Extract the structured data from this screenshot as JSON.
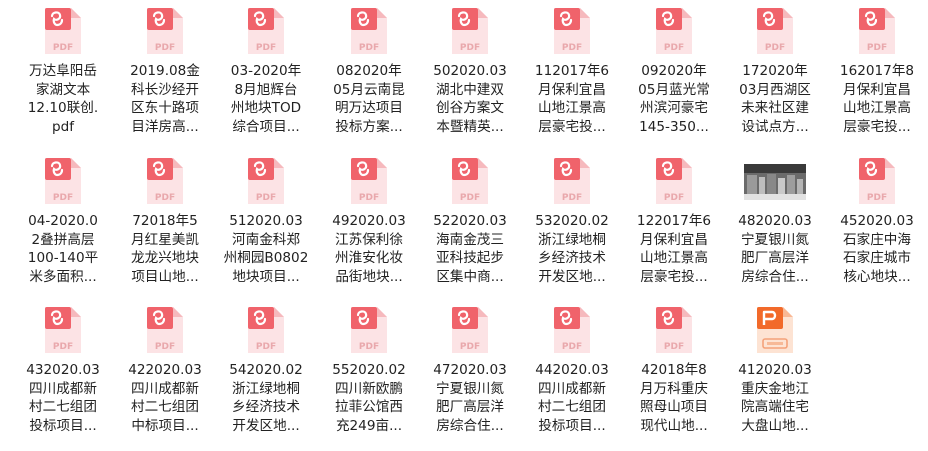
{
  "colors": {
    "pdf_red": "#F0636B",
    "pdf_light": "#FCE3E5",
    "wps_orange": "#F26A2A",
    "wps_light": "#FDE3D3",
    "label_text": "#222222"
  },
  "files": [
    {
      "name": "万达阜阳岳家湖文本12.10联创.pdf",
      "lines": [
        "万达阜阳岳",
        "家湖文本",
        "12.10联创.",
        "pdf"
      ],
      "icon": "pdf-icon"
    },
    {
      "name": "2019.08金科长沙经开区东十路项目洋房高...",
      "lines": [
        "2019.08金",
        "科长沙经开",
        "区东十路项",
        "目洋房高..."
      ],
      "icon": "pdf-icon"
    },
    {
      "name": "03-2020年8月旭辉台州地块TOD综合项目...",
      "lines": [
        "03-2020年",
        "8月旭辉台",
        "州地块TOD",
        "综合项目..."
      ],
      "icon": "pdf-icon"
    },
    {
      "name": "082020年05月云南昆明万达项目投标方案...",
      "lines": [
        "082020年",
        "05月云南昆",
        "明万达项目",
        "投标方案..."
      ],
      "icon": "pdf-icon"
    },
    {
      "name": "502020.03湖北中建双创谷方案文本暨精英...",
      "lines": [
        "502020.03",
        "湖北中建双",
        "创谷方案文",
        "本暨精英..."
      ],
      "icon": "pdf-icon"
    },
    {
      "name": "112017年6月保利宜昌山地江景高层豪宅投...",
      "lines": [
        "112017年6",
        "月保利宜昌",
        "山地江景高",
        "层豪宅投..."
      ],
      "icon": "pdf-icon"
    },
    {
      "name": "092020年05月蓝光常州滨河豪宅145-350...",
      "lines": [
        "092020年",
        "05月蓝光常",
        "州滨河豪宅",
        "145-350..."
      ],
      "icon": "pdf-icon"
    },
    {
      "name": "172020年03月西湖区未来社区建设试点方...",
      "lines": [
        "172020年",
        "03月西湖区",
        "未来社区建",
        "设试点方..."
      ],
      "icon": "pdf-icon"
    },
    {
      "name": "162017年8月保利宜昌山地江景高层豪宅投...",
      "lines": [
        "162017年8",
        "月保利宜昌",
        "山地江景高",
        "层豪宅投..."
      ],
      "icon": "pdf-icon"
    },
    {
      "name": "04-2020.02叠拼高层100-140平米多面积...",
      "lines": [
        "04-2020.0",
        "2叠拼高层",
        "100-140平",
        "米多面积..."
      ],
      "icon": "pdf-icon"
    },
    {
      "name": "72018年5月红星美凯龙龙兴地块项目山地...",
      "lines": [
        "72018年5",
        "月红星美凯",
        "龙龙兴地块",
        "项目山地..."
      ],
      "icon": "pdf-icon"
    },
    {
      "name": "512020.03河南金科郑州桐园B0802地块项目...",
      "lines": [
        "512020.03",
        "河南金科郑",
        "州桐园B0802",
        "地块项目..."
      ],
      "icon": "pdf-icon"
    },
    {
      "name": "492020.03江苏保利徐州淮安化妆品街地块...",
      "lines": [
        "492020.03",
        "江苏保利徐",
        "州淮安化妆",
        "品街地块..."
      ],
      "icon": "pdf-icon"
    },
    {
      "name": "522020.03海南金茂三亚科技起步区集中商...",
      "lines": [
        "522020.03",
        "海南金茂三",
        "亚科技起步",
        "区集中商..."
      ],
      "icon": "pdf-icon"
    },
    {
      "name": "532020.02浙江绿地桐乡经济技术开发区地...",
      "lines": [
        "532020.02",
        "浙江绿地桐",
        "乡经济技术",
        "开发区地..."
      ],
      "icon": "pdf-icon"
    },
    {
      "name": "122017年6月保利宜昌山地江景高层豪宅投...",
      "lines": [
        "122017年6",
        "月保利宜昌",
        "山地江景高",
        "层豪宅投..."
      ],
      "icon": "pdf-icon"
    },
    {
      "name": "482020.03宁夏银川氮肥厂高层洋房综合住...",
      "lines": [
        "482020.03",
        "宁夏银川氮",
        "肥厂高层洋",
        "房综合住..."
      ],
      "icon": "image-thumbnail"
    },
    {
      "name": "452020.03石家庄中海石家庄城市核心地块...",
      "lines": [
        "452020.03",
        "石家庄中海",
        "石家庄城市",
        "核心地块..."
      ],
      "icon": "pdf-icon"
    },
    {
      "name": "432020.03四川成都新村二七组团投标项目...",
      "lines": [
        "432020.03",
        "四川成都新",
        "村二七组团",
        "投标项目..."
      ],
      "icon": "pdf-icon"
    },
    {
      "name": "422020.03四川成都新村二七组团中标项目...",
      "lines": [
        "422020.03",
        "四川成都新",
        "村二七组团",
        "中标项目..."
      ],
      "icon": "pdf-icon"
    },
    {
      "name": "542020.02浙江绿地桐乡经济技术开发区地...",
      "lines": [
        "542020.02",
        "浙江绿地桐",
        "乡经济技术",
        "开发区地..."
      ],
      "icon": "pdf-icon"
    },
    {
      "name": "552020.02四川新欧鹏拉菲公馆西充249亩...",
      "lines": [
        "552020.02",
        "四川新欧鹏",
        "拉菲公馆西",
        "充249亩..."
      ],
      "icon": "pdf-icon"
    },
    {
      "name": "472020.03宁夏银川氮肥厂高层洋房综合住...",
      "lines": [
        "472020.03",
        "宁夏银川氮",
        "肥厂高层洋",
        "房综合住..."
      ],
      "icon": "pdf-icon"
    },
    {
      "name": "442020.03四川成都新村二七组团投标项目...",
      "lines": [
        "442020.03",
        "四川成都新",
        "村二七组团",
        "投标项目..."
      ],
      "icon": "pdf-icon"
    },
    {
      "name": "42018年8月万科重庆照母山项目现代山地...",
      "lines": [
        "42018年8",
        "月万科重庆",
        "照母山项目",
        "现代山地..."
      ],
      "icon": "pdf-icon"
    },
    {
      "name": "412020.03重庆金地江院高端住宅大盘山地...",
      "lines": [
        "412020.03",
        "重庆金地江",
        "院高端住宅",
        "大盘山地..."
      ],
      "icon": "wps-icon"
    }
  ]
}
